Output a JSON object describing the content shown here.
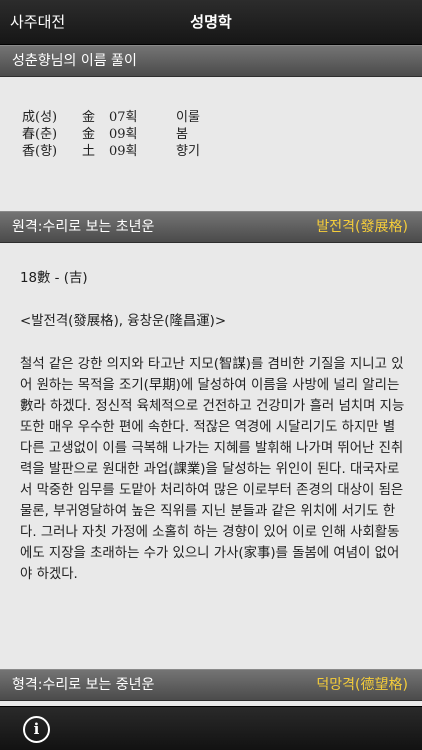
{
  "navbar": {
    "back_label": "사주대전",
    "title": "성명학"
  },
  "section_name": {
    "title": "성춘향님의 이름 풀이"
  },
  "name_rows": [
    {
      "hanja": "成(성)",
      "element": "金",
      "strokes": "07획",
      "meaning": "이룰"
    },
    {
      "hanja": "春(춘)",
      "element": "金",
      "strokes": "09획",
      "meaning": "봄"
    },
    {
      "hanja": "香(향)",
      "element": "土",
      "strokes": "09획",
      "meaning": "향기"
    }
  ],
  "section_wongyeok": {
    "title": "원격:수리로 보는 초년운",
    "result": "발전격(發展格)"
  },
  "wongyeok": {
    "number": "18數 - (吉)",
    "subtitle": "<발전격(發展格), 융창운(隆昌運)>",
    "body": "철석 같은 강한 의지와 타고난 지모(智謀)를 겸비한 기질을 지니고 있어 원하는 목적을 조기(早期)에 달성하여 이름을 사방에 널리 알리는 數라 하겠다. 정신적 육체적으로 건전하고 건강미가 흘러 넘치며 지능 또한 매우 우수한 편에 속한다. 적잖은 역경에 시달리기도 하지만 별다른 고생없이 이를 극복해 나가는 지혜를 발휘해 나가며 뛰어난 진취력을 발판으로 원대한 과업(課業)을 달성하는 위인이 된다. 대국자로서 막중한 임무를 도맡아 처리하여 많은 이로부터 존경의 대상이 됨은 물론, 부귀영달하여 높은 직위를 지닌 분들과 같은 위치에 서기도 한다. 그러나 자칫 가정에 소홀히 하는 경향이 있어 이로 인해 사회활동에도 지장을 초래하는 수가 있으니 가사(家事)를 돌봄에 여념이 없어야 하겠다."
  },
  "section_hyeonggyeok": {
    "title": "형격:수리로 보는 중년운",
    "result": "덕망격(德望格)"
  },
  "bottom_bar": {
    "info_symbol": "i"
  },
  "colors": {
    "accent": "#f5cd3a",
    "header_bg": "#5e5e5e",
    "navbar_bg": "#1f1f1f",
    "page_bg": "#e9e9e9"
  }
}
